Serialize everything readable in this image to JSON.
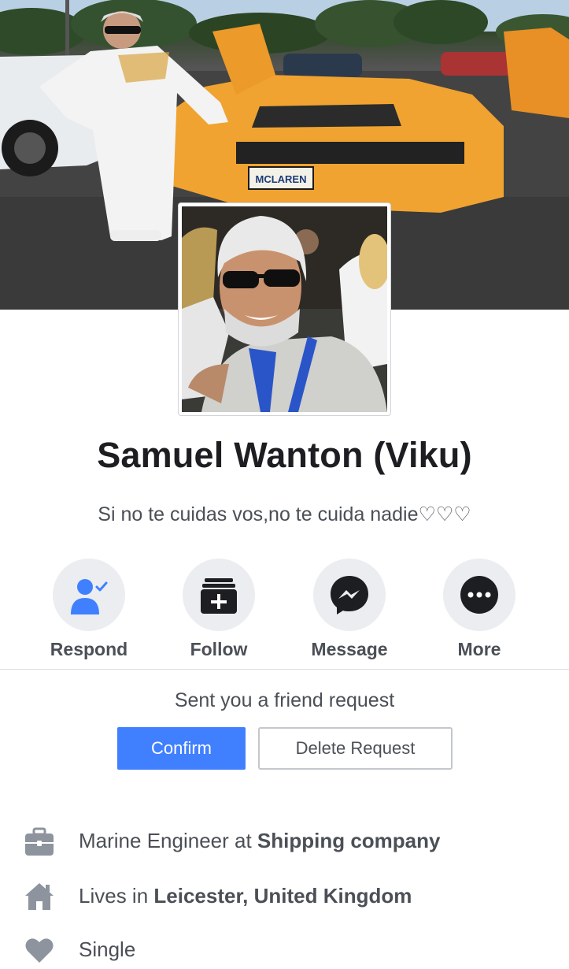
{
  "profile": {
    "name": "Samuel Wanton (Viku)",
    "bio": "Si no te cuidas vos,no te cuida nadie♡♡♡"
  },
  "cover": {
    "license_plate": "MCLAREN"
  },
  "actions": [
    {
      "label": "Respond",
      "icon": "person-check-icon"
    },
    {
      "label": "Follow",
      "icon": "follow-add-icon"
    },
    {
      "label": "Message",
      "icon": "messenger-icon"
    },
    {
      "label": "More",
      "icon": "more-dots-icon"
    }
  ],
  "friend_request": {
    "text": "Sent you a friend request",
    "confirm_label": "Confirm",
    "delete_label": "Delete Request"
  },
  "info": {
    "work": {
      "prefix": "Marine Engineer at ",
      "bold": "Shipping company",
      "icon": "briefcase-icon"
    },
    "home": {
      "prefix": "Lives in ",
      "bold": "Leicester, United Kingdom",
      "icon": "house-icon"
    },
    "relationship": {
      "prefix": "Single",
      "icon": "heart-icon"
    }
  },
  "colors": {
    "accent": "#4080ff",
    "action_icon": "#1c1e21",
    "respond_icon": "#4080ff",
    "circle_bg": "#ebedf0",
    "text_primary": "#1c1e21",
    "text_secondary": "#4b4f56",
    "info_icon": "#8d949e"
  }
}
